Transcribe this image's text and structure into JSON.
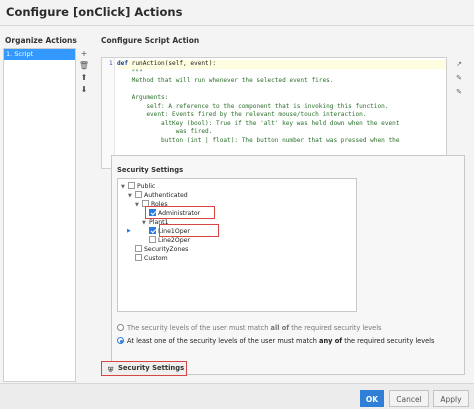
{
  "window": {
    "title": "Configure [onClick] Actions"
  },
  "organize": {
    "header": "Organize Actions",
    "items": [
      "1. Script"
    ],
    "tools": {
      "add": "+",
      "delete": "🗑",
      "up": "⬆",
      "down": "⬇"
    }
  },
  "script": {
    "header": "Configure Script Action",
    "line_number": "1",
    "def_keyword": "def",
    "def_rest": " runAction(self, event):",
    "lines": [
      "    \"\"\"",
      "    Method that will run whenever the selected event fires.",
      "",
      "    Arguments:",
      "        self: A reference to the component that is invoking this function.",
      "        event: Events fired by the relevant mouse/touch interaction.",
      "            altKey (bool): True if the 'alt' key was held down when the event",
      "                was fired.",
      "            button (int | float): The button number that was pressed when the"
    ],
    "side_tools": [
      "↗",
      "✎",
      "✎"
    ]
  },
  "security": {
    "title": "Security Settings",
    "tree": {
      "public": "Public",
      "authenticated": "Authenticated",
      "roles": "Roles",
      "administrator": "Administrator",
      "plant1": "Plant1",
      "line1oper": "Line1Oper",
      "line2oper": "Line2Oper",
      "security_zones": "SecurityZones",
      "custom": "Custom"
    },
    "radio_all_prefix": "The security levels of the user must match ",
    "radio_all_bold": "all of",
    "radio_all_suffix": " the required security levels",
    "radio_any_prefix": "At least one of the security levels of the user must match ",
    "radio_any_bold": "any of",
    "radio_any_suffix": " the required security levels",
    "selected_mode": "any"
  },
  "security_button": {
    "label": "Security Settings",
    "icon": "shield-icon"
  },
  "footer": {
    "ok": "OK",
    "cancel": "Cancel",
    "apply": "Apply"
  },
  "colors": {
    "accent": "#2f7fd6",
    "selection": "#3399ff",
    "highlight_box": "#d94545"
  }
}
